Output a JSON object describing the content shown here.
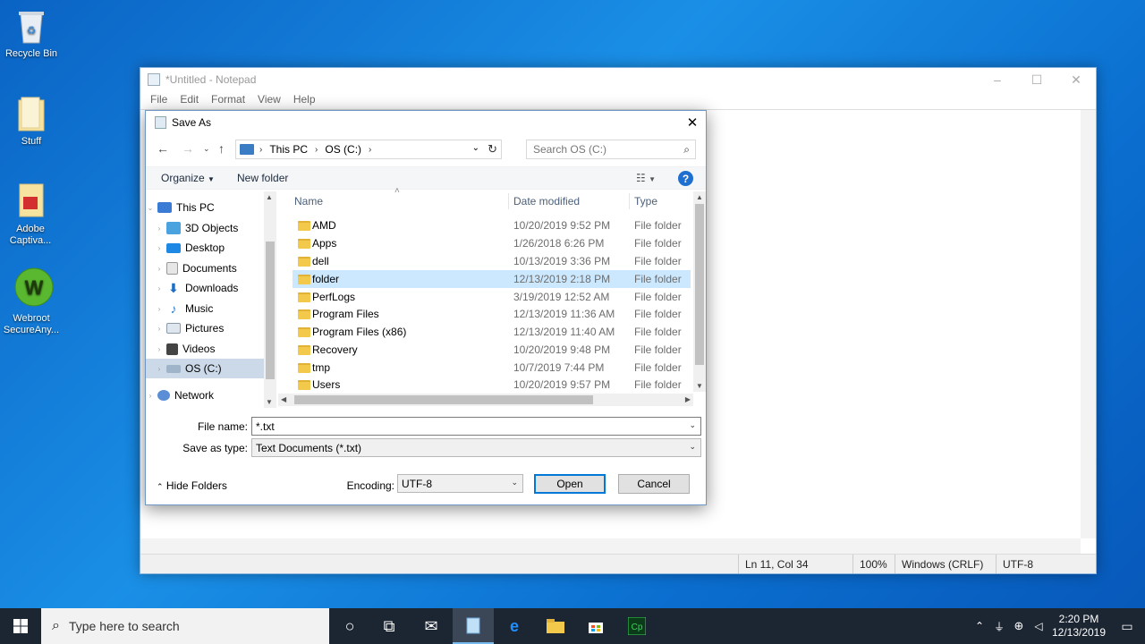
{
  "desktop": {
    "icons": [
      {
        "label": "Recycle Bin"
      },
      {
        "label": "Stuff"
      },
      {
        "label": "Adobe Captiva..."
      },
      {
        "label": "Webroot SecureAny..."
      }
    ]
  },
  "notepad": {
    "title": "*Untitled - Notepad",
    "menu": [
      "File",
      "Edit",
      "Format",
      "View",
      "Help"
    ],
    "status": {
      "position": "Ln 11, Col 34",
      "zoom": "100%",
      "line_ending": "Windows (CRLF)",
      "encoding": "UTF-8"
    }
  },
  "dialog": {
    "title": "Save As",
    "address": {
      "crumbs": [
        "This PC",
        "OS (C:)"
      ]
    },
    "search_placeholder": "Search OS (C:)",
    "toolbar": {
      "organize": "Organize",
      "new_folder": "New folder"
    },
    "nav": [
      {
        "label": "This PC"
      },
      {
        "label": "3D Objects"
      },
      {
        "label": "Desktop"
      },
      {
        "label": "Documents"
      },
      {
        "label": "Downloads"
      },
      {
        "label": "Music"
      },
      {
        "label": "Pictures"
      },
      {
        "label": "Videos"
      },
      {
        "label": "OS (C:)"
      },
      {
        "label": "Network"
      }
    ],
    "columns": {
      "name": "Name",
      "date": "Date modified",
      "type": "Type"
    },
    "files": [
      {
        "name": "AMD",
        "date": "10/20/2019 9:52 PM",
        "type": "File folder"
      },
      {
        "name": "Apps",
        "date": "1/26/2018 6:26 PM",
        "type": "File folder"
      },
      {
        "name": "dell",
        "date": "10/13/2019 3:36 PM",
        "type": "File folder"
      },
      {
        "name": "folder",
        "date": "12/13/2019 2:18 PM",
        "type": "File folder"
      },
      {
        "name": "PerfLogs",
        "date": "3/19/2019 12:52 AM",
        "type": "File folder"
      },
      {
        "name": "Program Files",
        "date": "12/13/2019 11:36 AM",
        "type": "File folder"
      },
      {
        "name": "Program Files (x86)",
        "date": "12/13/2019 11:40 AM",
        "type": "File folder"
      },
      {
        "name": "Recovery",
        "date": "10/20/2019 9:48 PM",
        "type": "File folder"
      },
      {
        "name": "tmp",
        "date": "10/7/2019 7:44 PM",
        "type": "File folder"
      },
      {
        "name": "Users",
        "date": "10/20/2019 9:57 PM",
        "type": "File folder"
      }
    ],
    "file_name": {
      "label": "File name:",
      "value": "*.txt"
    },
    "save_type": {
      "label": "Save as type:",
      "value": "Text Documents (*.txt)"
    },
    "hide_folders": "Hide Folders",
    "encoding": {
      "label": "Encoding:",
      "value": "UTF-8"
    },
    "buttons": {
      "open": "Open",
      "cancel": "Cancel"
    }
  },
  "taskbar": {
    "search_placeholder": "Type here to search",
    "clock_time": "2:20 PM",
    "clock_date": "12/13/2019"
  },
  "colors": {
    "accent": "#0078d7",
    "selection": "#cce8ff",
    "folder": "#f2c94a",
    "taskbar": "#1c2532"
  }
}
